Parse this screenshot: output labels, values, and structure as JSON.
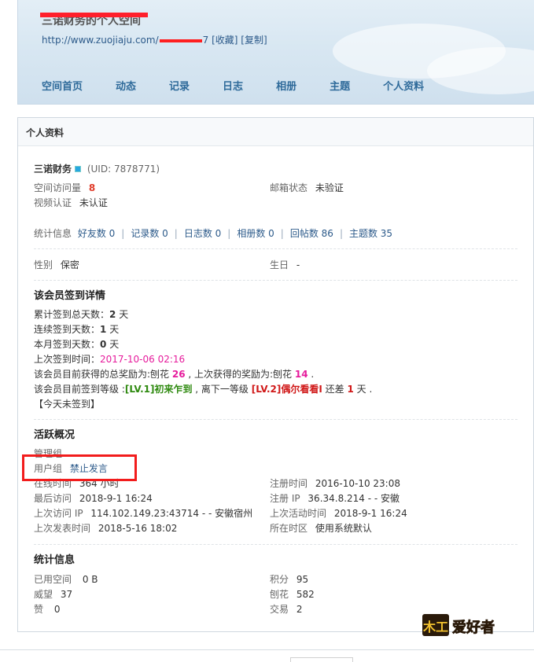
{
  "header": {
    "site_title": "三诺财务的个人空间",
    "url_prefix": "http://www.zuojiaju.com/",
    "url_suffix": "7",
    "favorite_link": "[收藏]",
    "copy_link": "[复制]",
    "nav": [
      "空间首页",
      "动态",
      "记录",
      "日志",
      "相册",
      "主题",
      "个人资料"
    ]
  },
  "panel": {
    "title": "个人资料"
  },
  "user": {
    "name": "三诺财务",
    "uid": "(UID: 7878771)",
    "space_visits_label": "空间访问量",
    "space_visits_value": "8",
    "email_status_label": "邮箱状态",
    "email_status_value": "未验证",
    "video_auth_label": "视频认证",
    "video_auth_value": "未认证"
  },
  "stats": {
    "label": "统计信息",
    "items": [
      "好友数 0",
      "记录数 0",
      "日志数 0",
      "相册数 0",
      "回帖数 86",
      "主题数 35"
    ]
  },
  "basic": {
    "gender_label": "性别",
    "gender_value": "保密",
    "birthday_label": "生日",
    "birthday_value": "-"
  },
  "signin": {
    "title": "该会员签到详情",
    "total_label": "累计签到总天数：",
    "total_value": "2",
    "total_unit": " 天",
    "streak_label": "连续签到天数：",
    "streak_value": "1",
    "streak_unit": " 天",
    "month_label": "本月签到天数：",
    "month_value": "0",
    "month_unit": " 天",
    "last_label": "上次签到时间：",
    "last_value": "2017-10-06 02:16",
    "reward_prefix": "该会员目前获得的总奖励为:刨花 ",
    "reward_total": "26",
    "reward_mid": " , 上次获得的奖励为:刨花 ",
    "reward_last": "14",
    "reward_end": " .",
    "level_prefix": "该会员目前签到等级 :",
    "level_current": "[LV.1]初来乍到",
    "level_mid": " , 离下一等级 ",
    "level_next": "[LV.2]偶尔看看I",
    "level_gap_prefix": " 还差 ",
    "level_gap": "1",
    "level_gap_unit": " 天 .",
    "today": "【今天未签到】"
  },
  "activity": {
    "title": "活跃概况",
    "admin_group_label": "管理组",
    "user_group_label": "用户组",
    "user_group_value": "禁止发言",
    "online_label": "在线时间",
    "online_value": "364 小时",
    "register_label": "注册时间",
    "register_value": "2016-10-10 23:08",
    "last_visit_label": "最后访问",
    "last_visit_value": "2018-9-1 16:24",
    "register_ip_label": "注册 IP",
    "register_ip_value": "36.34.8.214 - - 安徽",
    "last_ip_label": "上次访问 IP",
    "last_ip_value": "114.102.149.23:43714 - - 安徽宿州",
    "last_active_label": "上次活动时间",
    "last_active_value": "2018-9-1 16:24",
    "last_post_label": "上次发表时间",
    "last_post_value": "2018-5-16 18:02",
    "timezone_label": "所在时区",
    "timezone_value": "使用系统默认"
  },
  "statistics": {
    "title": "统计信息",
    "space_used_label": "已用空间",
    "space_used_value": "0 B",
    "points_label": "积分",
    "points_value": "95",
    "prestige_label": "威望",
    "prestige_value": "37",
    "shavings_label": "刨花",
    "shavings_value": "582",
    "likes_label": "赞",
    "likes_value": "0",
    "trades_label": "交易",
    "trades_value": "2"
  },
  "watermark": {
    "text": "木工爱好者"
  },
  "colors": {
    "highlight_box": "#f21c1c",
    "link_blue": "#2c5a8a",
    "nav_blue": "#2e6a9a"
  }
}
